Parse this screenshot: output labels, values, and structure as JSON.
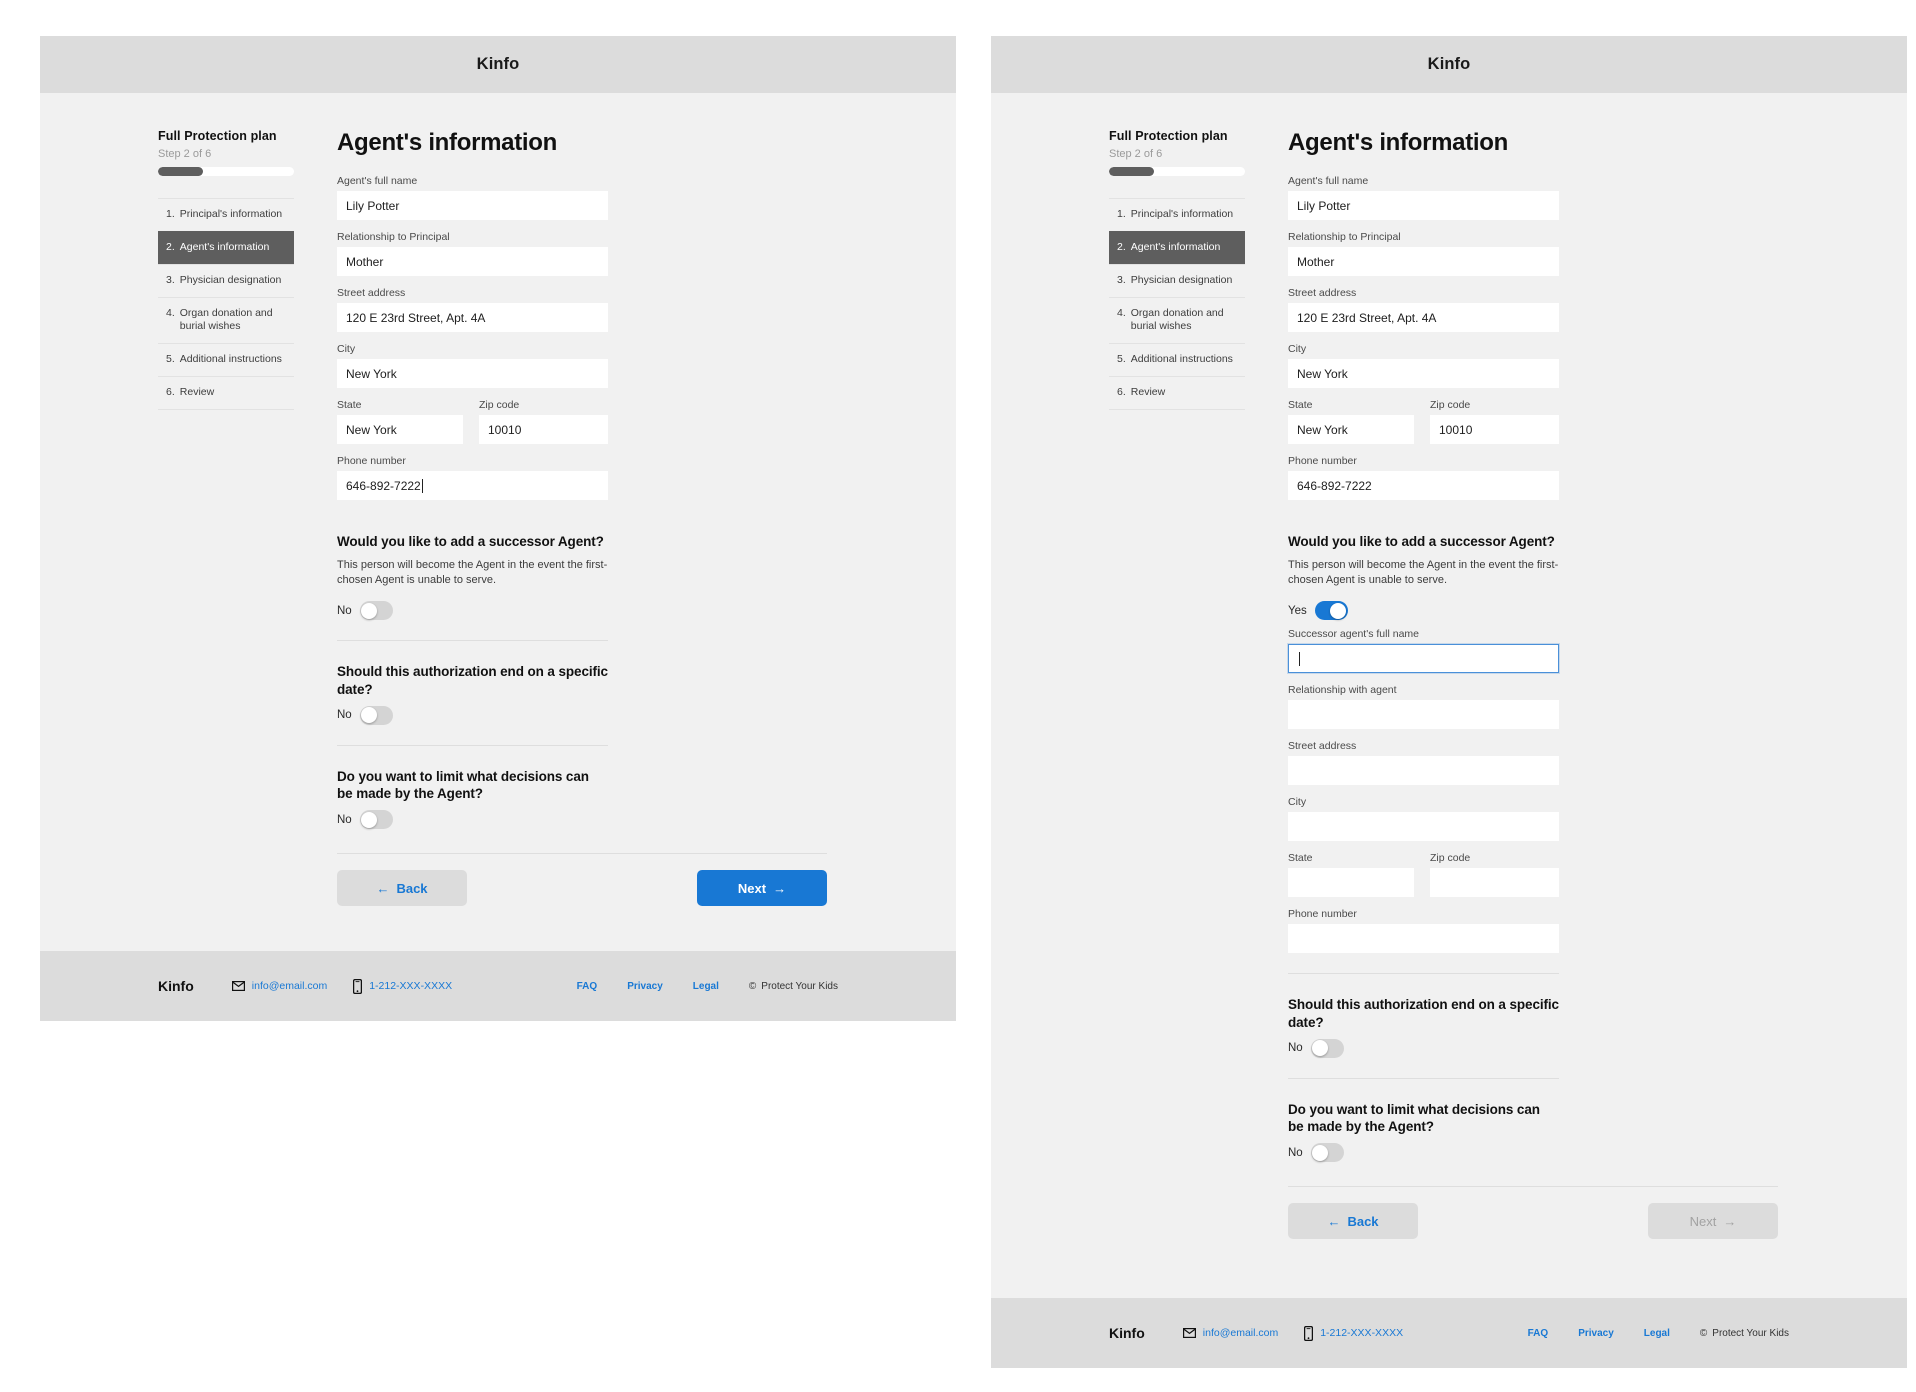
{
  "app": {
    "brand": "Kinfo"
  },
  "sidebar": {
    "plan_title": "Full Protection plan",
    "step_label": "Step 2 of 6",
    "progress_percent": 33,
    "items": [
      {
        "num": "1.",
        "label": "Principal's information",
        "active": false
      },
      {
        "num": "2.",
        "label": "Agent's information",
        "active": true
      },
      {
        "num": "3.",
        "label": "Physician designation",
        "active": false
      },
      {
        "num": "4.",
        "label": "Organ donation and burial wishes",
        "active": false
      },
      {
        "num": "5.",
        "label": "Additional instructions",
        "active": false
      },
      {
        "num": "6.",
        "label": "Review",
        "active": false
      }
    ]
  },
  "form": {
    "title": "Agent's information",
    "full_name_label": "Agent's full name",
    "full_name_value": "Lily Potter",
    "relationship_label": "Relationship to Principal",
    "relationship_value": "Mother",
    "street_label": "Street address",
    "street_value": "120 E 23rd Street, Apt. 4A",
    "city_label": "City",
    "city_value": "New York",
    "state_label": "State",
    "state_value": "New York",
    "zip_label": "Zip code",
    "zip_value": "10010",
    "phone_label": "Phone number",
    "phone_value": "646-892-7222"
  },
  "questions": {
    "successor": {
      "title": "Would you like to add a successor Agent?",
      "desc": "This person will become the Agent in the event the first-chosen Agent is unable to serve.",
      "toggle_off_label": "No",
      "toggle_on_label": "Yes"
    },
    "end_date": {
      "title": "Should this authorization end on a specific date?",
      "toggle_label": "No"
    },
    "limit_decisions": {
      "title": "Do you want to limit what decisions can be made by the Agent?",
      "toggle_label": "No"
    }
  },
  "successor_form": {
    "full_name_label": "Successor agent's full name",
    "full_name_value": "",
    "relationship_label": "Relationship with agent",
    "relationship_value": "",
    "street_label": "Street address",
    "street_value": "",
    "city_label": "City",
    "city_value": "",
    "state_label": "State",
    "state_value": "",
    "zip_label": "Zip code",
    "zip_value": "",
    "phone_label": "Phone number",
    "phone_value": ""
  },
  "nav": {
    "back_label": "Back",
    "next_label": "Next",
    "back_arrow": "←",
    "next_arrow": "→"
  },
  "footer": {
    "brand": "Kinfo",
    "email": "info@email.com",
    "phone": "1-212-XXX-XXXX",
    "faq": "FAQ",
    "privacy": "Privacy",
    "legal": "Legal",
    "copyright": "Protect Your Kids",
    "copyright_symbol": "©"
  },
  "colors": {
    "accent": "#1878d4",
    "active_nav": "#5e5e5e",
    "panel_bg": "#f1f1f1",
    "header_bg": "#dcdcdc"
  }
}
